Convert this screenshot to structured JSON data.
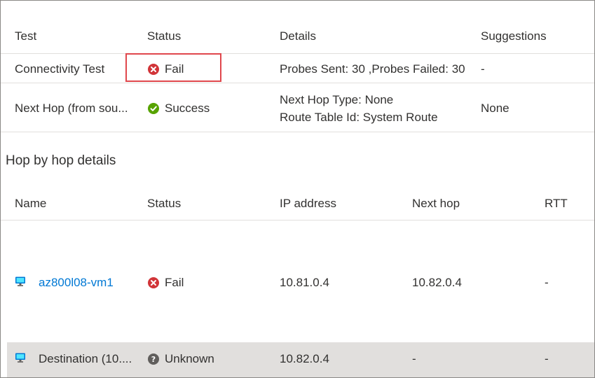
{
  "diagnostics": {
    "columns": [
      "Test",
      "Status",
      "Details",
      "Suggestions"
    ],
    "rows": [
      {
        "test": "Connectivity Test",
        "status": "Fail",
        "status_icon": "fail-icon",
        "details": [
          "Probes Sent: 30 ,Probes Failed: 30"
        ],
        "suggestions": "-"
      },
      {
        "test": "Next Hop (from sou...",
        "status": "Success",
        "status_icon": "success-icon",
        "details": [
          "Next Hop Type: None",
          "Route Table Id: System Route"
        ],
        "suggestions": "None"
      }
    ]
  },
  "hops": {
    "title": "Hop by hop details",
    "columns": [
      "Name",
      "Status",
      "IP address",
      "Next hop",
      "RTT"
    ],
    "rows": [
      {
        "name": "az800l08-vm1",
        "status": "Fail",
        "status_icon": "fail-icon",
        "ip": "10.81.0.4",
        "next_hop": "10.82.0.4",
        "rtt": "-"
      },
      {
        "name": "Destination (10....",
        "status": "Unknown",
        "status_icon": "unknown-icon",
        "ip": "10.82.0.4",
        "next_hop": "-",
        "rtt": "-"
      }
    ]
  },
  "colors": {
    "fail": "#d13438",
    "success": "#57a300",
    "unknown": "#605e5c",
    "link": "#0078d4",
    "highlight_box": "#e0474c",
    "selected_row": "#e1dfdd"
  }
}
